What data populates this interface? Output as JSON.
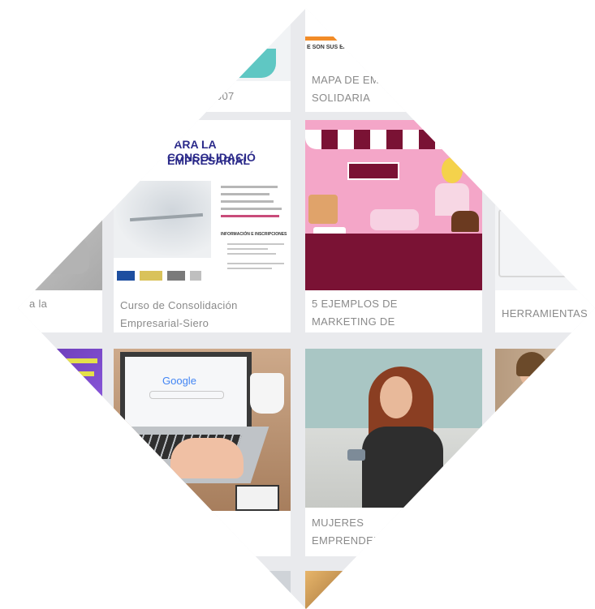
{
  "cards": {
    "top_left_caption": ".007",
    "top_right_caption": "MAPA DE EMI\nSOLIDARIA",
    "top_right_thumb_text": "E SON SUS EMPRE",
    "left_edge_caption": "a la",
    "consolidacion": {
      "caption": "Curso de Consolidación\nEmpresarial-Siero",
      "poster_title_1": "PARA LA CONSOLIDACIÓ",
      "poster_title_2": "EMPRESARIAL",
      "poster_info_heading": "INFORMACIÓN E INSCRIPCIONES"
    },
    "marketing": {
      "caption": "5 EJEMPLOS DE\nMARKETING DE"
    },
    "herramientas": {
      "caption": "HERRAMIENTAS"
    },
    "laptop": {
      "screen_text": "Google"
    },
    "mujeres": {
      "caption": "MUJERES\nEMPRENDED"
    }
  },
  "colors": {
    "background": "#e9eaed",
    "card": "#ffffff",
    "caption_text": "#8a8a8a",
    "pink": "#f4a6c8",
    "maroon": "#7a1234",
    "poster_blue": "#2b2a8a",
    "orange_accent": "#f28c28",
    "teal": "#5fc7c3"
  }
}
